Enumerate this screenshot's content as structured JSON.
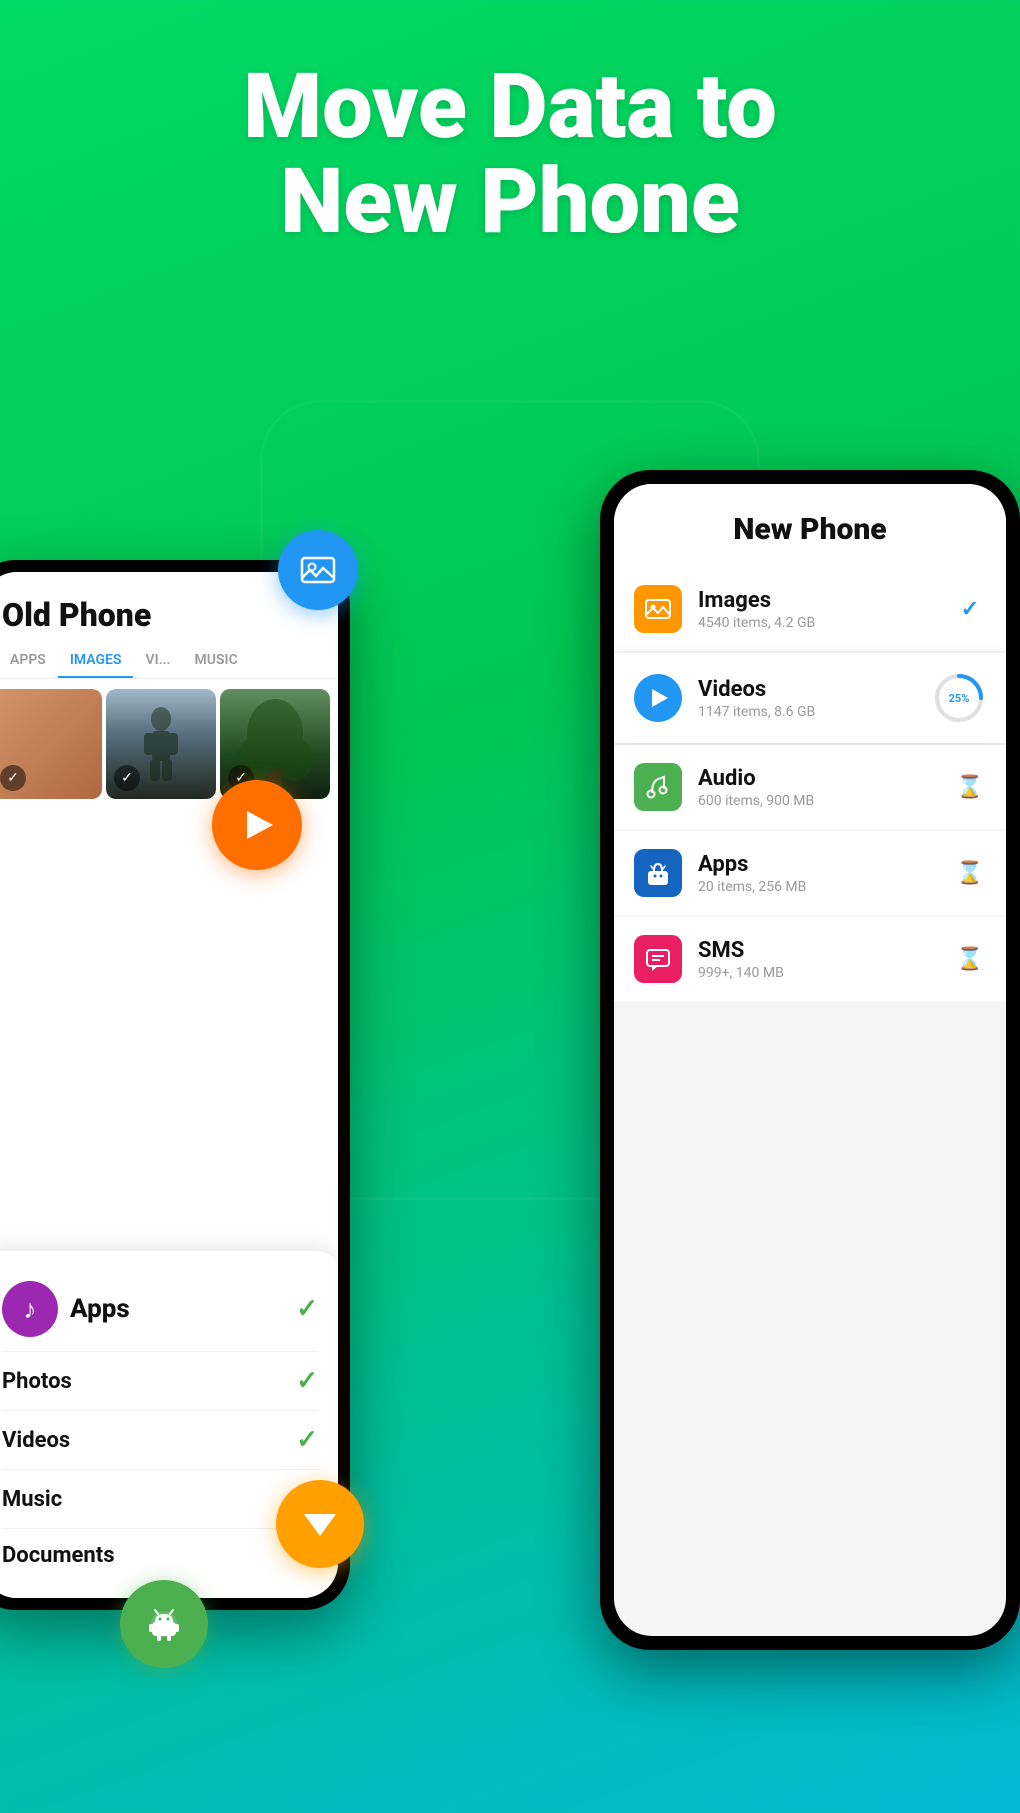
{
  "hero": {
    "title_line1": "Move Data to",
    "title_line2": "New Phone"
  },
  "old_phone": {
    "title": "Old Phone",
    "tabs": [
      "APPS",
      "IMAGES",
      "VI...",
      "MUSIC"
    ],
    "active_tab": "IMAGES",
    "list": [
      {
        "name": "Apps",
        "checked": true
      },
      {
        "name": "Photos",
        "checked": true
      },
      {
        "name": "Videos",
        "checked": true
      },
      {
        "name": "Music",
        "checked": true
      },
      {
        "name": "Documents",
        "checked": false
      }
    ]
  },
  "new_phone": {
    "title": "New Phone",
    "items": [
      {
        "name": "Images",
        "sub": "4540 items, 4.2 GB",
        "status": "check",
        "icon_type": "images"
      },
      {
        "name": "Videos",
        "sub": "1147 items, 8.6 GB",
        "status": "progress",
        "progress": 25,
        "icon_type": "videos"
      },
      {
        "name": "Audio",
        "sub": "600 items, 900 MB",
        "status": "hourglass",
        "icon_type": "audio"
      },
      {
        "name": "Apps",
        "sub": "20 items, 256 MB",
        "status": "hourglass",
        "icon_type": "apps"
      },
      {
        "name": "SMS",
        "sub": "999+, 140 MB",
        "status": "hourglass",
        "icon_type": "sms"
      }
    ]
  },
  "floating_icons": {
    "photo_icon": "🖼",
    "play_icon": "▶",
    "down_arrow": "▼",
    "android_icon": "🤖"
  },
  "colors": {
    "green_bg": "#00d964",
    "blue": "#2196F3",
    "orange": "#FF6F00",
    "purple": "#9C27B0",
    "yellow": "#FFA000",
    "green_btn": "#4CAF50"
  }
}
